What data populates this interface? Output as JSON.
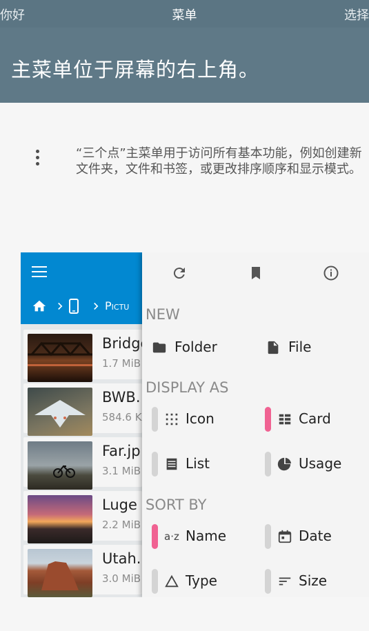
{
  "topbar": {
    "left": "你好",
    "title": "菜单",
    "right": "选择"
  },
  "header": {
    "title": "主菜单位于屏幕的右上角。"
  },
  "description": "“三个点”主菜单用于访问所有基本功能，例如创建新文件夹，文件和书签，或更改排序顺序和显示模式。",
  "screenshot": {
    "breadcrumb_path": "Pictu",
    "files": [
      {
        "name": "Bridge",
        "size": "1.7 MiB"
      },
      {
        "name": "BWB.",
        "size": "584.6 K"
      },
      {
        "name": "Far.jp",
        "size": "3.1 MiB"
      },
      {
        "name": "Luge",
        "size": "2.2 MiB"
      },
      {
        "name": "Utah.",
        "size": "3.0 MiB"
      }
    ],
    "menu": {
      "new_label": "NEW",
      "folder": "Folder",
      "file": "File",
      "display_label": "DISPLAY AS",
      "icon": "Icon",
      "card": "Card",
      "list": "List",
      "usage": "Usage",
      "sort_label": "SORT BY",
      "name": "Name",
      "date": "Date",
      "type": "Type",
      "size": "Size"
    }
  },
  "colors": {
    "accent": "#0288d1",
    "selected": "#f06292",
    "header": "#5f7987"
  }
}
